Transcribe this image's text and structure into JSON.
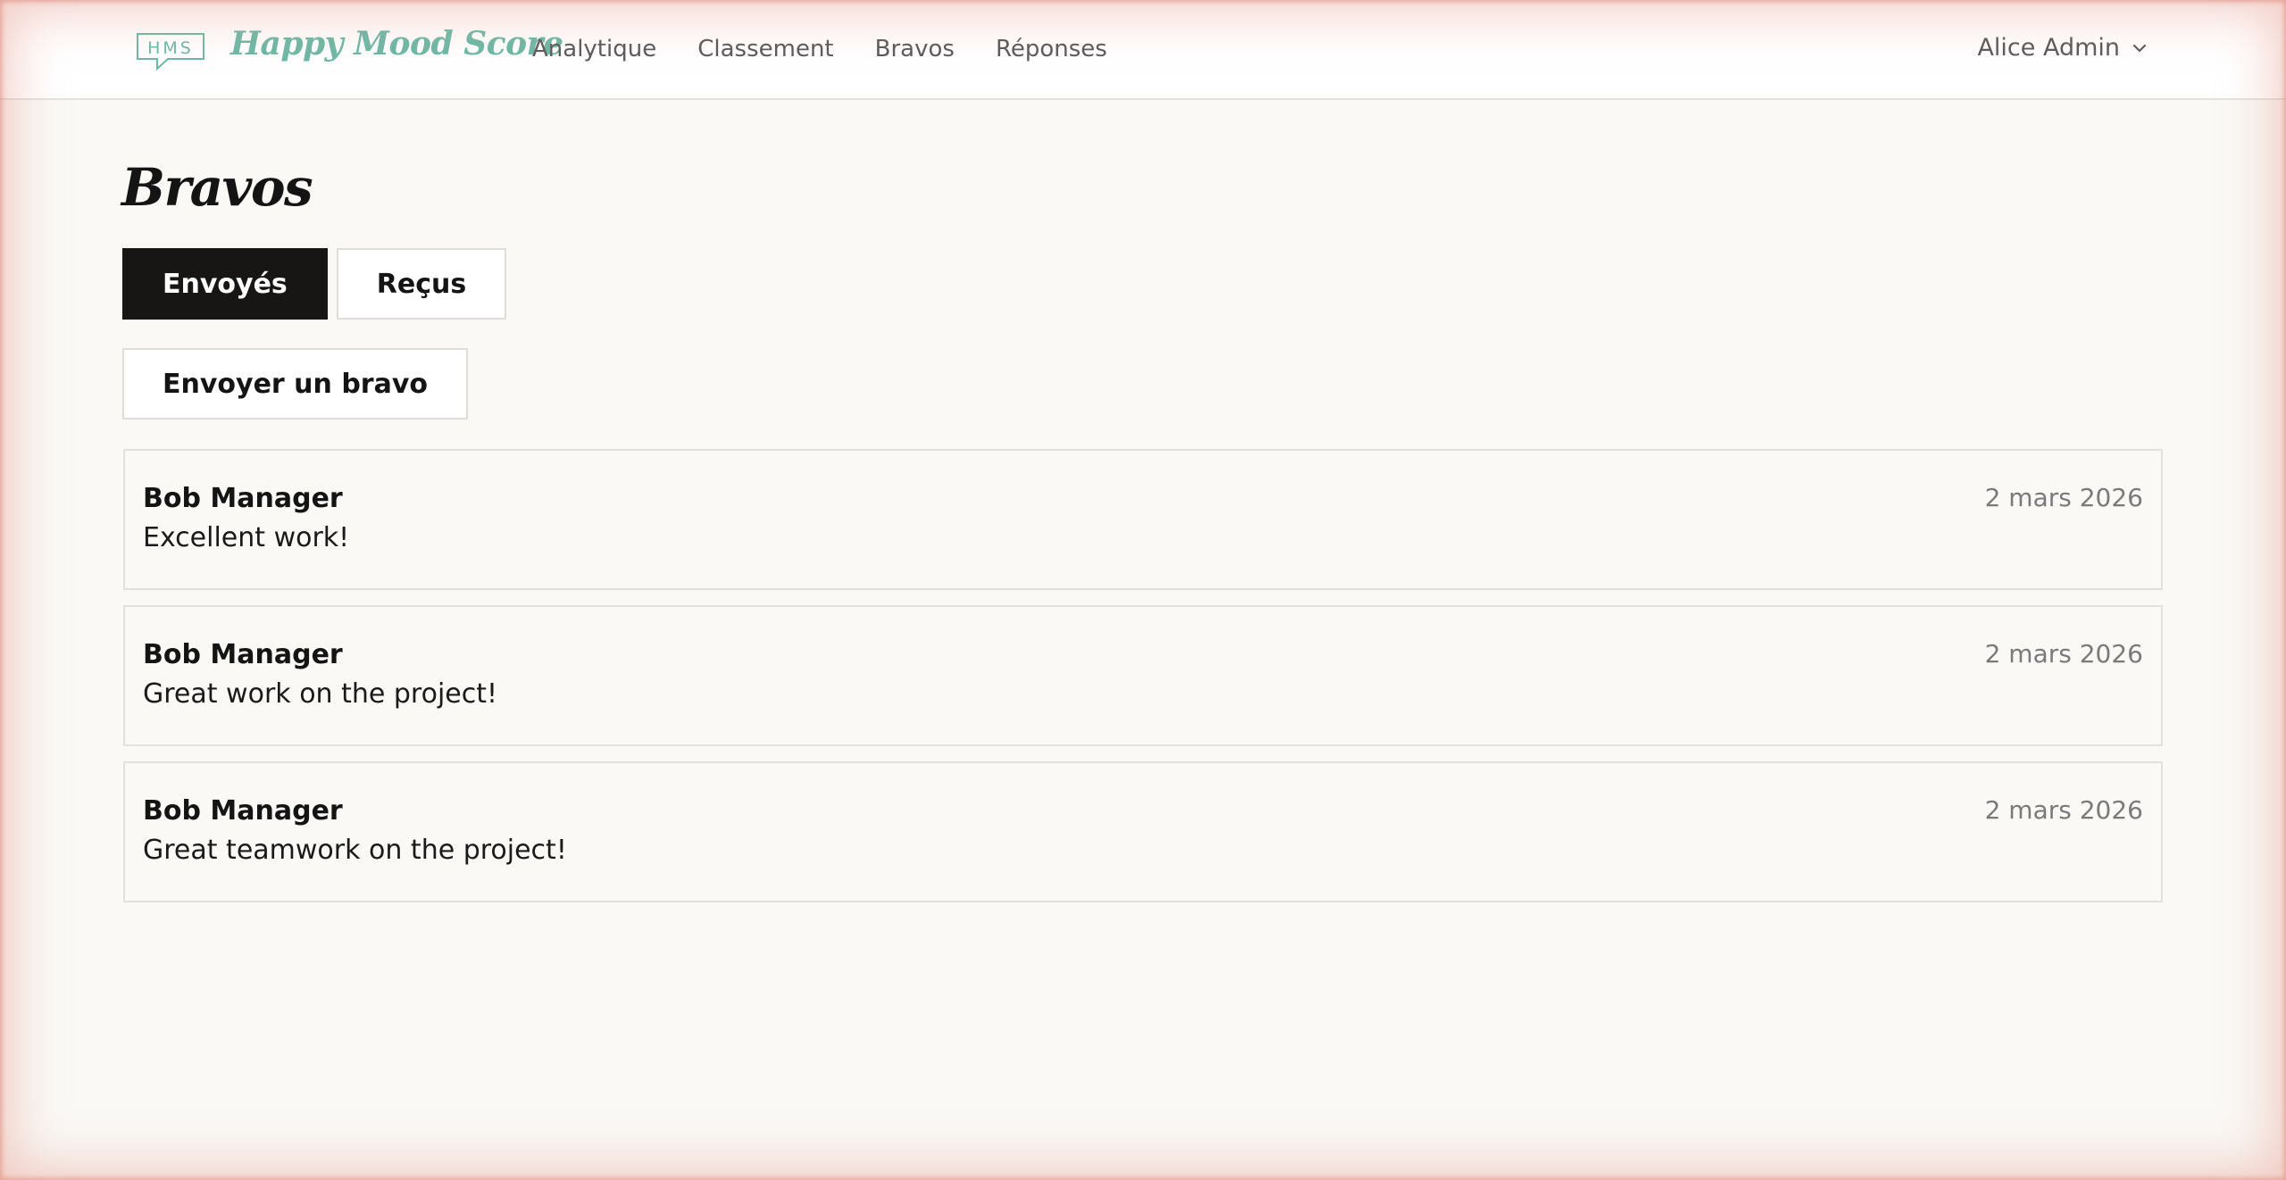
{
  "header": {
    "logo_text": "HMS",
    "brand": "Happy Mood Score",
    "nav": [
      {
        "label": "Analytique"
      },
      {
        "label": "Classement"
      },
      {
        "label": "Bravos"
      },
      {
        "label": "Réponses"
      }
    ],
    "user": "Alice Admin",
    "user_icon": "chevron-down-icon"
  },
  "main": {
    "title": "Bravos",
    "tabs": [
      {
        "label": "Envoyés",
        "active": true
      },
      {
        "label": "Reçus",
        "active": false
      }
    ],
    "send_button": "Envoyer un bravo",
    "bravos": [
      {
        "name": "Bob Manager",
        "message": "Excellent work!",
        "date": "2 mars 2026"
      },
      {
        "name": "Bob Manager",
        "message": "Great work on the project!",
        "date": "2 mars 2026"
      },
      {
        "name": "Bob Manager",
        "message": "Great teamwork on the project!",
        "date": "2 mars 2026"
      }
    ]
  },
  "colors": {
    "brand": "#6db8a6",
    "background": "#faf9f6",
    "active_tab": "#171614",
    "frame_glow": "#e8a092"
  }
}
